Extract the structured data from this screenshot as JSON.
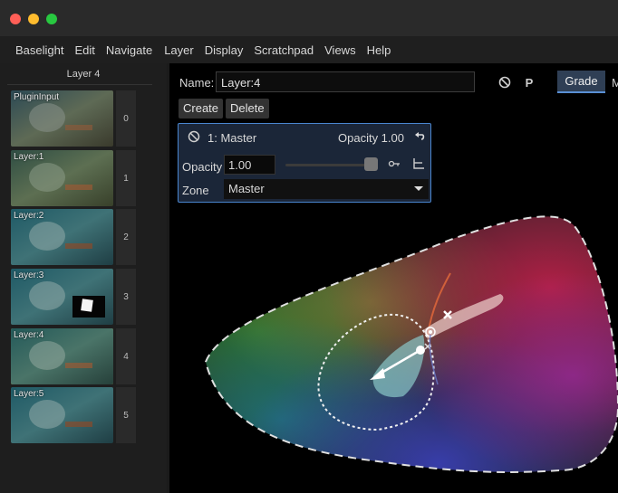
{
  "window": {
    "traffic_colors": [
      "#ff5f57",
      "#febc2e",
      "#28c840"
    ]
  },
  "menu": [
    "Baselight",
    "Edit",
    "Navigate",
    "Layer",
    "Display",
    "Scratchpad",
    "Views",
    "Help"
  ],
  "sidebar": {
    "title": "Layer 4",
    "layers": [
      {
        "label": "PluginInput",
        "number": "0"
      },
      {
        "label": "Layer:1",
        "number": "1"
      },
      {
        "label": "Layer:2",
        "number": "2"
      },
      {
        "label": "Layer:3",
        "number": "3"
      },
      {
        "label": "Layer:4",
        "number": "4"
      },
      {
        "label": "Layer:5",
        "number": "5"
      }
    ],
    "selected_index": 4
  },
  "header": {
    "name_label": "Name:",
    "name_value": "Layer:4",
    "p_button": "P",
    "tab_grade": "Grade",
    "tab_more": "M"
  },
  "actions": {
    "create": "Create",
    "delete": "Delete"
  },
  "master": {
    "title": "1: Master",
    "opacity_summary": "Opacity 1.00",
    "opacity_label": "Opacity",
    "opacity_value": "1.00",
    "opacity_level": 1.0,
    "zone_label": "Zone",
    "zone_value": "Master"
  },
  "colors": {
    "accent": "#4a86d0",
    "selected": "#c9b83a",
    "tab": "#2f3f55"
  }
}
